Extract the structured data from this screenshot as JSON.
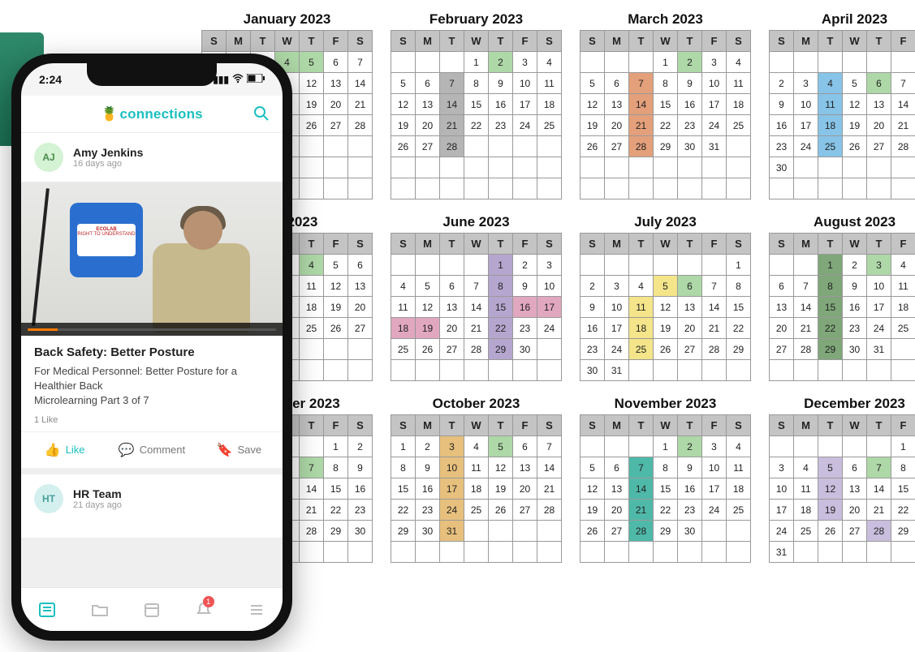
{
  "phone": {
    "status_time": "2:24",
    "brand": "connections",
    "post1": {
      "avatar_initials": "AJ",
      "author": "Amy Jenkins",
      "meta": "16 days ago",
      "sign_top": "ECOLAB",
      "sign_text": "RIGHT TO UNDERSTAND",
      "title": "Back Safety: Better Posture",
      "line1": "For Medical Personnel: Better Posture for a Healthier Back",
      "line2": "Microlearning Part 3 of 7",
      "likes": "1 Like"
    },
    "post2": {
      "avatar_initials": "HT",
      "author": "HR Team",
      "meta": "21 days ago"
    },
    "actions": {
      "like": "Like",
      "comment": "Comment",
      "save": "Save"
    },
    "nav_badge": "1"
  },
  "dow": [
    "S",
    "M",
    "T",
    "W",
    "T",
    "F",
    "S"
  ],
  "months": [
    {
      "title": "January 2023",
      "start": 0,
      "days": 31,
      "rows_min": 7,
      "hl": {
        "4": "c-grn",
        "5": "c-grn"
      }
    },
    {
      "title": "February 2023",
      "start": 3,
      "days": 28,
      "rows_min": 7,
      "hl": {
        "2": "c-grn",
        "7": "c-grey",
        "14": "c-grey",
        "21": "c-grey",
        "28": "c-grey"
      }
    },
    {
      "title": "March 2023",
      "start": 3,
      "days": 31,
      "rows_min": 7,
      "hl": {
        "2": "c-grn",
        "7": "c-org",
        "14": "c-org",
        "21": "c-org",
        "28": "c-org"
      }
    },
    {
      "title": "April 2023",
      "start": 6,
      "days": 30,
      "rows_min": 7,
      "hl": {
        "4": "c-blu",
        "6": "c-grn",
        "11": "c-blu",
        "18": "c-blu",
        "25": "c-blu"
      }
    },
    {
      "title": "May 2023",
      "start": 1,
      "days": 31,
      "rows_min": 6,
      "hl": {
        "4": "c-grn"
      }
    },
    {
      "title": "June 2023",
      "start": 4,
      "days": 30,
      "rows_min": 6,
      "hl": {
        "1": "c-purp",
        "8": "c-purp",
        "15": "c-purp",
        "16": "c-pink",
        "17": "c-pink",
        "18": "c-pink",
        "19": "c-pink",
        "22": "c-purp",
        "29": "c-purp"
      }
    },
    {
      "title": "July 2023",
      "start": 6,
      "days": 31,
      "rows_min": 6,
      "hl": {
        "5": "c-yel",
        "6": "c-grn",
        "11": "c-yel",
        "18": "c-yel",
        "25": "c-yel"
      }
    },
    {
      "title": "August 2023",
      "start": 2,
      "days": 31,
      "rows_min": 6,
      "hl": {
        "1": "c-drkgn",
        "3": "c-grn",
        "8": "c-drkgn",
        "15": "c-drkgn",
        "22": "c-drkgn",
        "29": "c-drkgn"
      }
    },
    {
      "title": "September 2023",
      "start": 5,
      "days": 30,
      "rows_min": 6,
      "hl": {
        "7": "c-grn"
      }
    },
    {
      "title": "October 2023",
      "start": 0,
      "days": 31,
      "rows_min": 6,
      "hl": {
        "3": "c-tan",
        "5": "c-grn",
        "10": "c-tan",
        "17": "c-tan",
        "24": "c-tan",
        "31": "c-tan"
      }
    },
    {
      "title": "November 2023",
      "start": 3,
      "days": 30,
      "rows_min": 6,
      "hl": {
        "2": "c-grn",
        "7": "c-teal",
        "14": "c-teal",
        "21": "c-teal",
        "28": "c-teal"
      }
    },
    {
      "title": "December 2023",
      "start": 5,
      "days": 31,
      "rows_min": 6,
      "hl": {
        "5": "c-lprp",
        "7": "c-grn",
        "12": "c-lprp",
        "19": "c-lprp",
        "28": "c-lprp"
      }
    }
  ]
}
